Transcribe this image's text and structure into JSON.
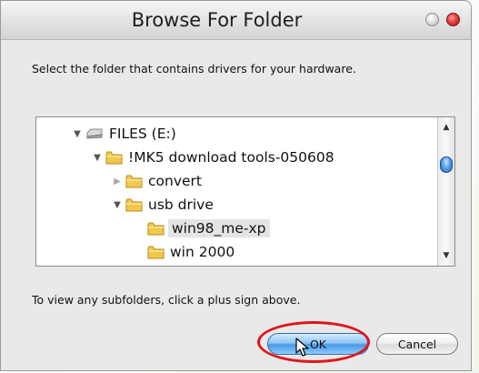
{
  "dialog": {
    "title": "Browse For Folder",
    "instruction": "Select the folder that contains drivers for your hardware.",
    "hint": "To view any subfolders, click a plus sign above.",
    "ok_label": "OK",
    "cancel_label": "Cancel"
  },
  "tree": {
    "items": [
      {
        "label": "FILES (E:)",
        "expanded": true,
        "icon": "drive-icon"
      },
      {
        "label": "!MK5 download tools-050608",
        "expanded": true,
        "icon": "folder-icon"
      },
      {
        "label": "convert",
        "expanded": false,
        "icon": "folder-icon"
      },
      {
        "label": "usb drive",
        "expanded": true,
        "icon": "folder-icon"
      },
      {
        "label": "win98_me-xp",
        "selected": true,
        "icon": "folder-icon"
      },
      {
        "label": "win 2000",
        "icon": "folder-icon"
      }
    ]
  },
  "colors": {
    "highlight_ring": "#e0141b",
    "ok_button": "#4a98e6",
    "close_button": "#e04040",
    "folder": "#f2c94c"
  }
}
